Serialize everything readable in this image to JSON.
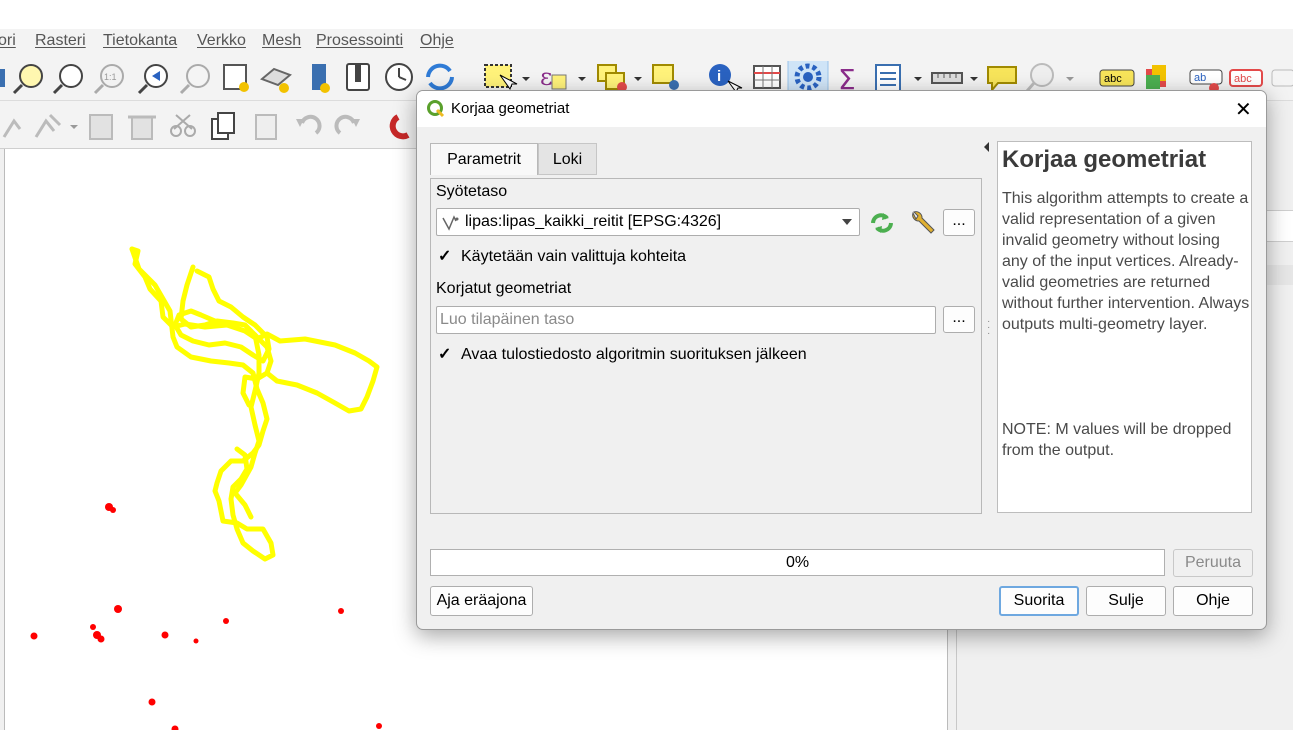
{
  "menu": [
    "ori",
    "Rasteri",
    "Tietokanta",
    "Verkko",
    "Mesh",
    "Prosessointi",
    "Ohje"
  ],
  "dialog": {
    "title": "Korjaa geometriat",
    "tabs": [
      "Parametrit",
      "Loki"
    ],
    "input_layer_label": "Syötetaso",
    "input_layer_value": "lipas:lipas_kaikki_reitit [EPSG:4326]",
    "selected_only_label": "Käytetään vain valittuja kohteita",
    "selected_only_checked": "✓",
    "output_label": "Korjatut geometriat",
    "output_placeholder": "Luo tilapäinen taso",
    "open_output_label": "Avaa tulostiedosto algoritmin suorituksen jälkeen",
    "open_output_checked": "✓",
    "ellipsis": "...",
    "help_title": "Korjaa geometriat",
    "help_text1": "This algorithm attempts to create a valid representation of a given invalid geometry without losing any of the input vertices. Already-valid geometries are returned without further intervention. Always outputs multi-geometry layer.",
    "help_text2": "NOTE: M values will be dropped from the output.",
    "progress_value": 0,
    "progress_text": "0%",
    "cancel_label": "Peruuta",
    "batch_label": "Aja eräajona",
    "run_label": "Suorita",
    "close_label": "Sulje",
    "help_label": "Ohje"
  },
  "colors": {
    "route": "#ffff00",
    "points": "#ff0000",
    "accent": "#0078d7"
  }
}
